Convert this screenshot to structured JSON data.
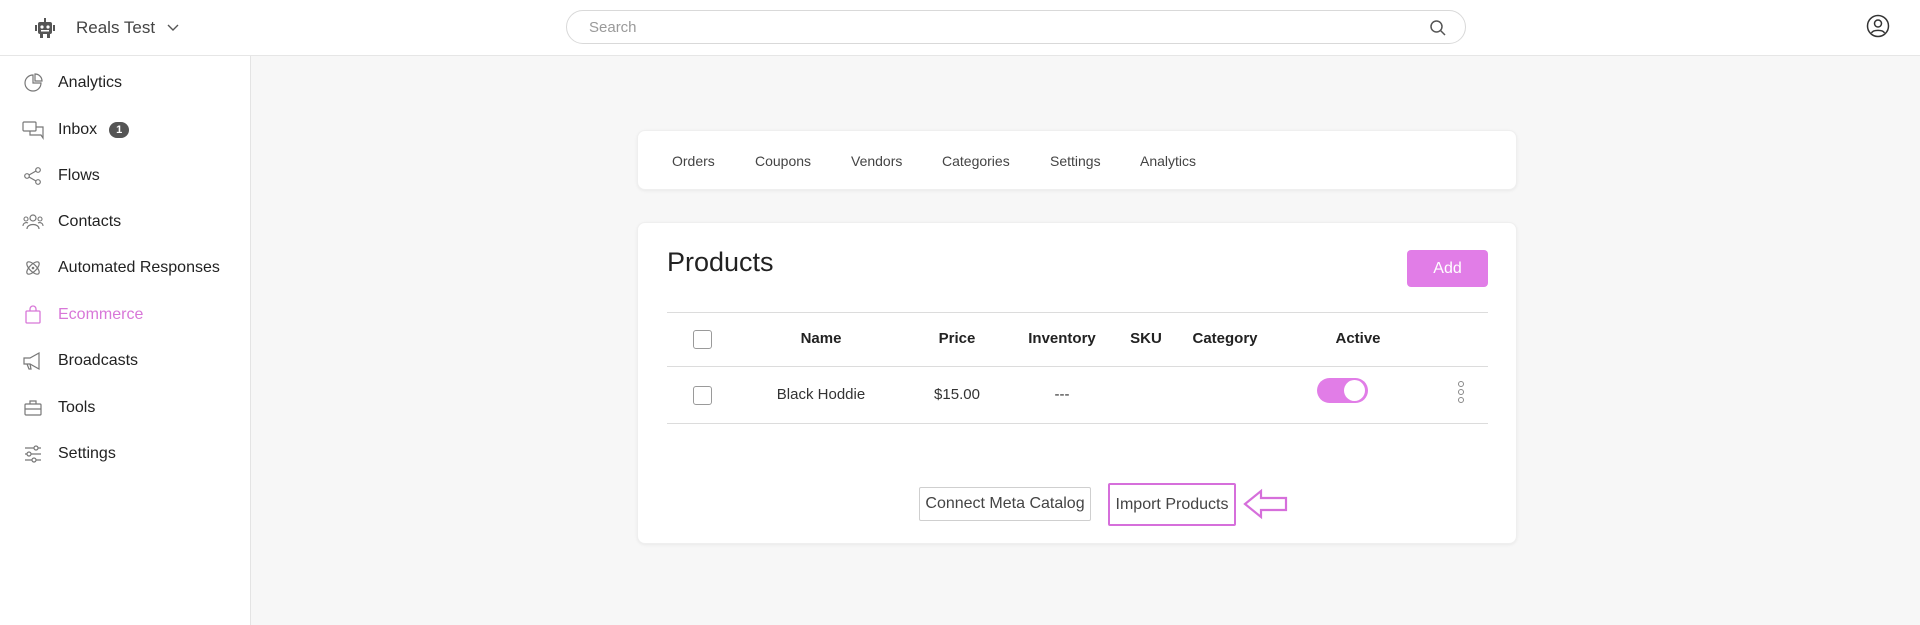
{
  "header": {
    "workspace_name": "Reals Test",
    "search_placeholder": "Search"
  },
  "sidebar": {
    "items": [
      {
        "label": "Analytics",
        "icon": "pie-chart-icon"
      },
      {
        "label": "Inbox",
        "icon": "chat-bubbles-icon",
        "badge": "1"
      },
      {
        "label": "Flows",
        "icon": "flows-icon"
      },
      {
        "label": "Contacts",
        "icon": "contacts-icon"
      },
      {
        "label": "Automated Responses",
        "icon": "atom-icon"
      },
      {
        "label": "Ecommerce",
        "icon": "shopping-bag-icon",
        "active": true
      },
      {
        "label": "Broadcasts",
        "icon": "megaphone-icon"
      },
      {
        "label": "Tools",
        "icon": "toolbox-icon"
      },
      {
        "label": "Settings",
        "icon": "sliders-icon"
      }
    ]
  },
  "tabs": [
    "Orders",
    "Coupons",
    "Vendors",
    "Categories",
    "Settings",
    "Analytics"
  ],
  "products": {
    "title": "Products",
    "add_label": "Add",
    "columns": [
      "Name",
      "Price",
      "Inventory",
      "SKU",
      "Category",
      "Active"
    ],
    "rows": [
      {
        "name": "Black Hoddie",
        "price": "$15.00",
        "inventory": "---",
        "sku": "",
        "category": "",
        "active": true
      }
    ],
    "connect_label": "Connect Meta Catalog",
    "import_label": "Import Products"
  },
  "colors": {
    "accent": "#e17de7",
    "active_nav": "#d877d8",
    "highlight_border": "#d66fdb"
  }
}
